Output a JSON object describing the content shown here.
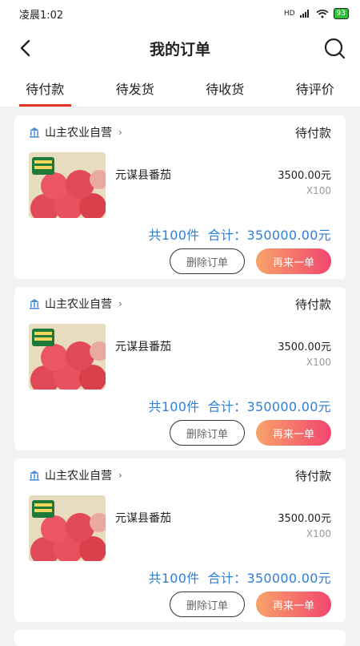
{
  "status_bar": {
    "time": "凌晨1:02",
    "signal": "HD",
    "battery": "93"
  },
  "nav": {
    "title": "我的订单"
  },
  "tabs": [
    {
      "label": "待付款",
      "active": true
    },
    {
      "label": "待发货",
      "active": false
    },
    {
      "label": "待收货",
      "active": false
    },
    {
      "label": "待评价",
      "active": false
    }
  ],
  "orders": [
    {
      "store": "山主农业自营",
      "status": "待付款",
      "product_name": "元谋县番茄",
      "price": "3500.00元",
      "qty": "X100",
      "count_text": "共100件",
      "total_text": "合计：350000.00元",
      "delete_label": "删除订单",
      "reorder_label": "再来一单"
    },
    {
      "store": "山主农业自营",
      "status": "待付款",
      "product_name": "元谋县番茄",
      "price": "3500.00元",
      "qty": "X100",
      "count_text": "共100件",
      "total_text": "合计：350000.00元",
      "delete_label": "删除订单",
      "reorder_label": "再来一单"
    },
    {
      "store": "山主农业自营",
      "status": "待付款",
      "product_name": "元谋县番茄",
      "price": "3500.00元",
      "qty": "X100",
      "count_text": "共100件",
      "total_text": "合计：350000.00元",
      "delete_label": "删除订单",
      "reorder_label": "再来一单"
    }
  ],
  "colors": {
    "accent": "#e63329",
    "total_blue": "#2f7fd6"
  },
  "icons": {
    "back": "back-arrow-icon",
    "search": "search-icon",
    "store": "store-icon"
  }
}
